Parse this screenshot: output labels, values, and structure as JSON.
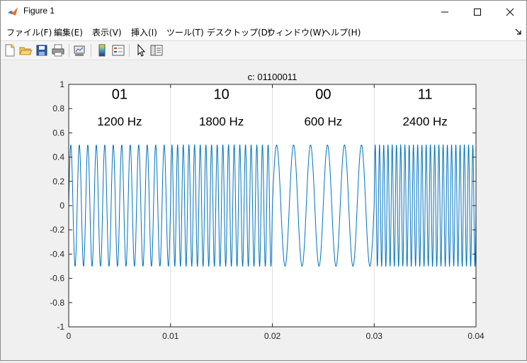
{
  "window": {
    "title": "Figure 1",
    "minimize_label": "─",
    "maximize_label": "☐",
    "close_label": "✕"
  },
  "menu": {
    "items": [
      {
        "label": "ファイル(F)"
      },
      {
        "label": "編集(E)"
      },
      {
        "label": "表示(V)"
      },
      {
        "label": "挿入(I)"
      },
      {
        "label": "ツール(T)"
      },
      {
        "label": "デスクトップ(D)"
      },
      {
        "label": "ウィンドウ(W)"
      },
      {
        "label": "ヘルプ(H)"
      }
    ]
  },
  "toolbar": {
    "icons": [
      "new-figure-icon",
      "open-file-icon",
      "save-icon",
      "print-icon",
      "link-plot-icon",
      "colorbar-icon",
      "legend-icon",
      "pointer-icon",
      "property-inspector-icon"
    ]
  },
  "chart_data": {
    "type": "line",
    "title": "c: 01100011",
    "xlabel": "",
    "ylabel": "",
    "xlim": [
      0,
      0.04
    ],
    "ylim": [
      -1,
      1
    ],
    "x_ticks": [
      "0",
      "0.01",
      "0.02",
      "0.03",
      "0.04"
    ],
    "y_ticks": [
      "1",
      "0.8",
      "0.6",
      "0.4",
      "0.2",
      "0",
      "-0.2",
      "-0.4",
      "-0.6",
      "-0.8",
      "-1"
    ],
    "grid_x": true,
    "grid_y": false,
    "line_color": "#0072bd",
    "amplitude": 0.5,
    "segments": [
      {
        "bits": "01",
        "freq_label": "1200 Hz",
        "x_start": 0,
        "x_end": 0.01,
        "frequency_hz": 1200
      },
      {
        "bits": "10",
        "freq_label": "1800 Hz",
        "x_start": 0.01,
        "x_end": 0.02,
        "frequency_hz": 1800
      },
      {
        "bits": "00",
        "freq_label": "600 Hz",
        "x_start": 0.02,
        "x_end": 0.03,
        "frequency_hz": 600
      },
      {
        "bits": "11",
        "freq_label": "2400 Hz",
        "x_start": 0.03,
        "x_end": 0.04,
        "frequency_hz": 2400
      }
    ]
  }
}
